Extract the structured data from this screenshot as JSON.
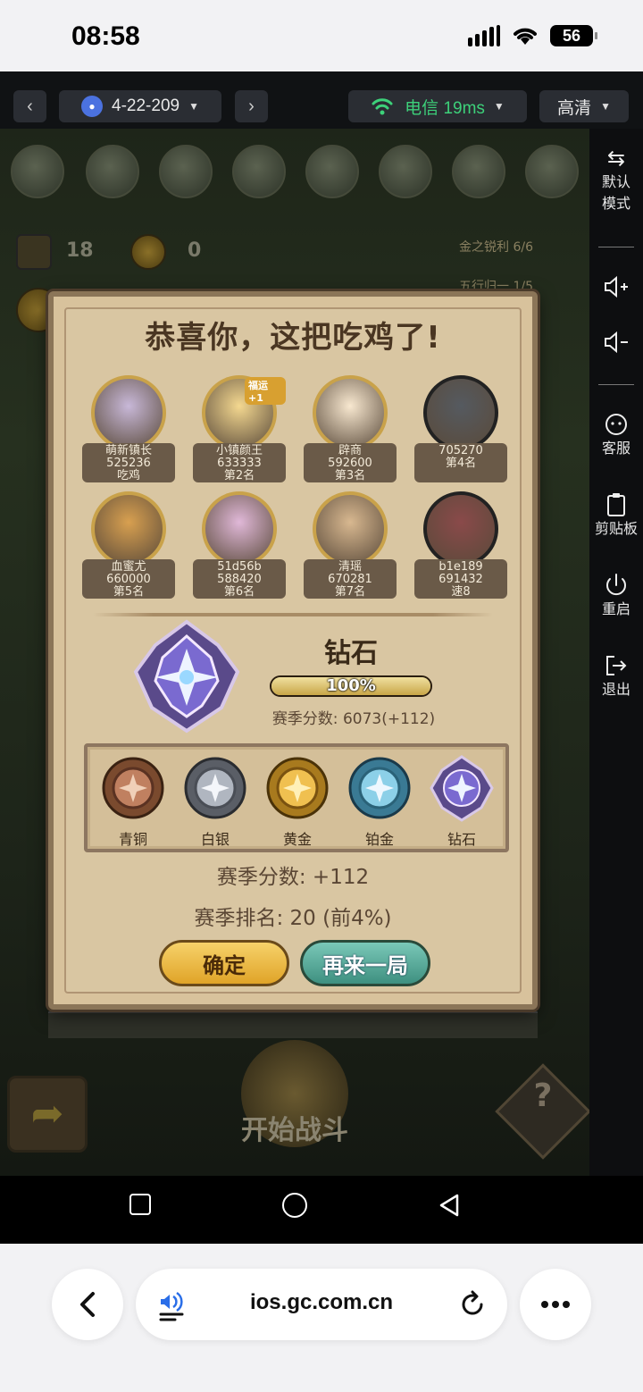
{
  "status_bar": {
    "time": "08:58",
    "battery": "56"
  },
  "topbar": {
    "device": "4-22-209",
    "network": "电信 19ms",
    "quality": "高清",
    "accent_green": "#3dd17a"
  },
  "side_panel": {
    "items": [
      {
        "label": "默认\n模式",
        "icon": "swap-icon"
      },
      {
        "label": "",
        "icon": "volume-up-icon"
      },
      {
        "label": "",
        "icon": "volume-down-icon"
      },
      {
        "label": "客服",
        "icon": "support-icon"
      },
      {
        "label": "剪贴板",
        "icon": "clipboard-icon"
      },
      {
        "label": "重启",
        "icon": "power-icon"
      },
      {
        "label": "退出",
        "icon": "exit-icon"
      }
    ]
  },
  "background_game": {
    "timer": "18",
    "coins": "0",
    "bonus1": "金之锐利 6/6",
    "bonus2": "五行归一 1/5",
    "start_battle": "开始战斗"
  },
  "modal": {
    "title": "恭喜你，这把吃鸡了!",
    "players": [
      {
        "name": "萌新镇长",
        "id": "525236",
        "place": "吃鸡",
        "badge": ""
      },
      {
        "name": "小镇颜王",
        "id": "633333",
        "place": "第2名",
        "badge": "福运+1"
      },
      {
        "name": "辟商",
        "id": "592600",
        "place": "第3名",
        "badge": ""
      },
      {
        "name": "",
        "id": "705270",
        "place": "第4名",
        "badge": ""
      },
      {
        "name": "血蜜尤",
        "id": "660000",
        "place": "第5名",
        "badge": ""
      },
      {
        "name": "51d56b",
        "id": "588420",
        "place": "第6名",
        "badge": ""
      },
      {
        "name": "清瑶",
        "id": "670281",
        "place": "第7名",
        "badge": ""
      },
      {
        "name": "b1e189",
        "id": "691432",
        "place": "速8",
        "badge": ""
      }
    ],
    "rank_name": "钻石",
    "progress_text": "100%",
    "progress_value": 1.0,
    "season_points_detail": "赛季分数: 6073(+112)",
    "ranks": [
      "青铜",
      "白银",
      "黄金",
      "铂金",
      "钻石"
    ],
    "season_points": "赛季分数: +112",
    "season_rank": "赛季排名: 20 (前4%)",
    "confirm_button": "确定",
    "again_button": "再来一局"
  },
  "browser": {
    "url": "ios.gc.com.cn"
  }
}
